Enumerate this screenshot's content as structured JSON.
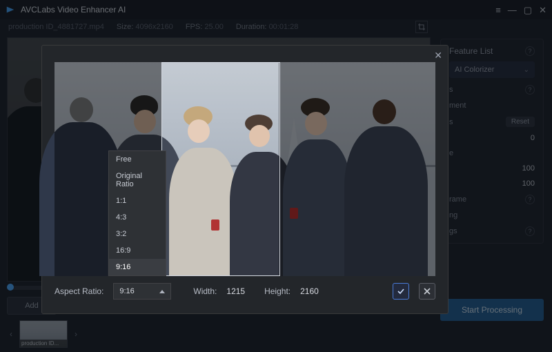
{
  "app": {
    "title": "AVCLabs Video Enhancer AI"
  },
  "file": {
    "name": "production ID_4881727.mp4",
    "size_label": "Size:",
    "size": "4096x2160",
    "fps_label": "FPS:",
    "fps": "25.00",
    "duration_label": "Duration:",
    "duration": "00:01:28"
  },
  "left": {
    "add_label": "Add",
    "thumb_caption": "production ID..."
  },
  "right": {
    "feature_title": "Feature List",
    "feature_selected": "AI Colorizer",
    "adjustment_label": "ment",
    "reset_label": "Reset",
    "val0": "0",
    "val100a": "100",
    "val100b": "100",
    "frame_label": "rame",
    "ng_label": "ng",
    "gs_label": "gs",
    "start_label": "Start Processing"
  },
  "crop": {
    "aspect_label": "Aspect Ratio:",
    "aspect_value": "9:16",
    "width_label": "Width:",
    "width_value": "1215",
    "height_label": "Height:",
    "height_value": "2160",
    "options": [
      "Free",
      "Original Ratio",
      "1:1",
      "4:3",
      "3:2",
      "16:9",
      "9:16"
    ]
  }
}
